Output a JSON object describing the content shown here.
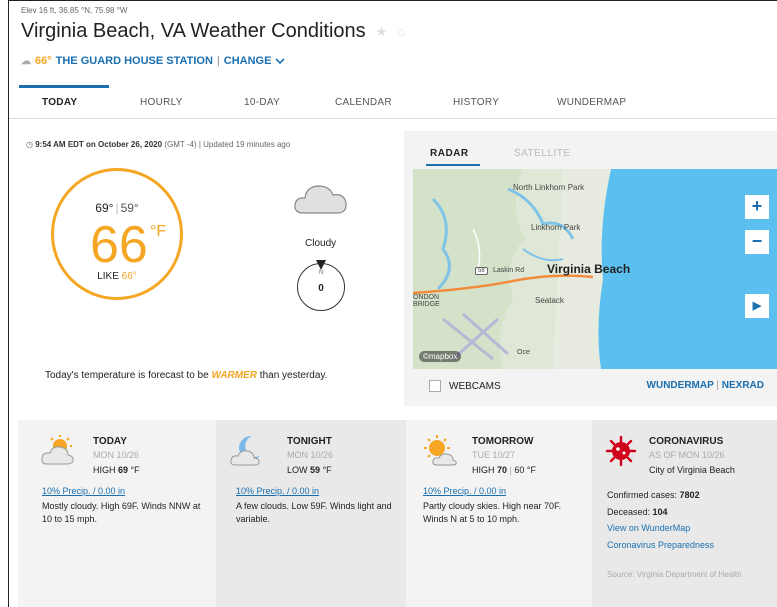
{
  "header": {
    "elevation": "Elev 16 ft, 36.85 °N, 75.98 °W",
    "title": "Virginia Beach, VA Weather Conditions",
    "star_icon": "star-icon",
    "home_icon": "home-icon",
    "station_temp": "66°",
    "station_name": "THE GUARD HOUSE STATION",
    "station_sep": "|",
    "change_label": "CHANGE"
  },
  "tabs": [
    {
      "label": "TODAY",
      "active": true
    },
    {
      "label": "HOURLY"
    },
    {
      "label": "10-DAY"
    },
    {
      "label": "CALENDAR"
    },
    {
      "label": "HISTORY"
    },
    {
      "label": "WUNDERMAP"
    }
  ],
  "current": {
    "time": "9:54 AM EDT on October 26, 2020",
    "tz": "(GMT -4)",
    "updated": "| Updated 19 minutes ago",
    "high": "69°",
    "low": "59°",
    "temp": "66",
    "unit": "°F",
    "like_label": "LIKE",
    "like_value": "66°",
    "condition": "Cloudy",
    "wind_speed": "0",
    "wind_dir_label": "N",
    "forecast_prefix": "Today's temperature is forecast to be",
    "forecast_word": "WARMER",
    "forecast_suffix": "than yesterday."
  },
  "map": {
    "tab_radar": "RADAR",
    "tab_satellite": "SATELLITE",
    "label_north": "North Linkhorn Park",
    "label_linkhorn": "Linkhorn Park",
    "label_laskin": "Laskin Rd",
    "label_route": "58",
    "label_city": "Virginia Beach",
    "label_seatack": "Seatack",
    "label_london": "ONDON BRIDGE",
    "label_oce": "Oce",
    "mapbox": "©mapbox",
    "zoom_in": "+",
    "zoom_out": "−",
    "play": "▶",
    "webcams": "WEBCAMS",
    "link_wundermap": "WUNDERMAP",
    "link_sep": "|",
    "link_nexrad": "NEXRAD"
  },
  "forecast_cards": [
    {
      "title": "TODAY",
      "date": "MON 10/26",
      "hl_label": "HIGH",
      "hl_value": "69",
      "hl_unit": "°F",
      "precip": "10% Precip. / 0.00 in",
      "text": "Mostly cloudy. High 69F. Winds NNW at 10 to 15 mph.",
      "icon": "partly-cloudy-sun-icon"
    },
    {
      "title": "TONIGHT",
      "date": "MON 10/26",
      "hl_label": "LOW",
      "hl_value": "59",
      "hl_unit": "°F",
      "precip": "10% Precip. / 0.00 in",
      "text": "A few clouds. Low 59F. Winds light and variable.",
      "icon": "moon-cloud-icon"
    },
    {
      "title": "TOMORROW",
      "date": "TUE 10/27",
      "hl_label": "HIGH",
      "hl_value": "70",
      "hl_sep": "|",
      "hl_low": "60 °F",
      "precip": "10% Precip. / 0.00 in",
      "text": "Partly cloudy skies. High near 70F. Winds N at 5 to 10 mph.",
      "icon": "sun-cloud-icon"
    }
  ],
  "corona": {
    "title": "CORONAVIRUS",
    "as_of": "AS OF MON 10/26",
    "place": "City of Virginia Beach",
    "confirmed_label": "Confirmed cases:",
    "confirmed_value": "7802",
    "deceased_label": "Deceased:",
    "deceased_value": "104",
    "link_map": "View on WunderMap",
    "link_prep": "Coronavirus Preparedness",
    "source": "Source: Virginia Department of Health",
    "icon": "virus-icon"
  }
}
